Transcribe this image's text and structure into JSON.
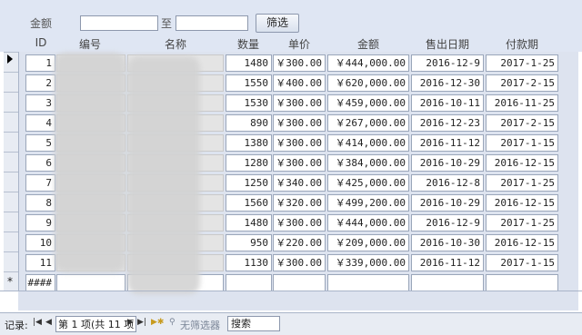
{
  "filter": {
    "label": "金额",
    "to_label": "至",
    "from_value": "",
    "to_value": "",
    "button_label": "筛选"
  },
  "columns": [
    "ID",
    "编号",
    "名称",
    "数量",
    "单价",
    "金额",
    "售出日期",
    "付款期"
  ],
  "rows": [
    {
      "id": "1",
      "qty": "1480",
      "price": "￥300.00",
      "amount": "￥444,000.00",
      "sold": "2016-12-9",
      "pay": "2017-1-25"
    },
    {
      "id": "2",
      "qty": "1550",
      "price": "￥400.00",
      "amount": "￥620,000.00",
      "sold": "2016-12-30",
      "pay": "2017-2-15"
    },
    {
      "id": "3",
      "qty": "1530",
      "price": "￥300.00",
      "amount": "￥459,000.00",
      "sold": "2016-10-11",
      "pay": "2016-11-25"
    },
    {
      "id": "4",
      "qty": "890",
      "price": "￥300.00",
      "amount": "￥267,000.00",
      "sold": "2016-12-23",
      "pay": "2017-2-15"
    },
    {
      "id": "5",
      "qty": "1380",
      "price": "￥300.00",
      "amount": "￥414,000.00",
      "sold": "2016-11-12",
      "pay": "2017-1-15"
    },
    {
      "id": "6",
      "qty": "1280",
      "price": "￥300.00",
      "amount": "￥384,000.00",
      "sold": "2016-10-29",
      "pay": "2016-12-15"
    },
    {
      "id": "7",
      "qty": "1250",
      "price": "￥340.00",
      "amount": "￥425,000.00",
      "sold": "2016-12-8",
      "pay": "2017-1-25"
    },
    {
      "id": "8",
      "qty": "1560",
      "price": "￥320.00",
      "amount": "￥499,200.00",
      "sold": "2016-10-29",
      "pay": "2016-12-15"
    },
    {
      "id": "9",
      "qty": "1480",
      "price": "￥300.00",
      "amount": "￥444,000.00",
      "sold": "2016-12-9",
      "pay": "2017-1-25"
    },
    {
      "id": "10",
      "qty": "950",
      "price": "￥220.00",
      "amount": "￥209,000.00",
      "sold": "2016-10-30",
      "pay": "2016-12-15"
    },
    {
      "id": "11",
      "qty": "1130",
      "price": "￥300.00",
      "amount": "￥339,000.00",
      "sold": "2016-11-12",
      "pay": "2017-1-15"
    }
  ],
  "new_row": {
    "id": "####",
    "marker": "*"
  },
  "status": {
    "record_label": "记录:",
    "position_text": "第 1 项(共 11 项",
    "filter_text": "无筛选器",
    "search_placeholder": "搜索"
  }
}
